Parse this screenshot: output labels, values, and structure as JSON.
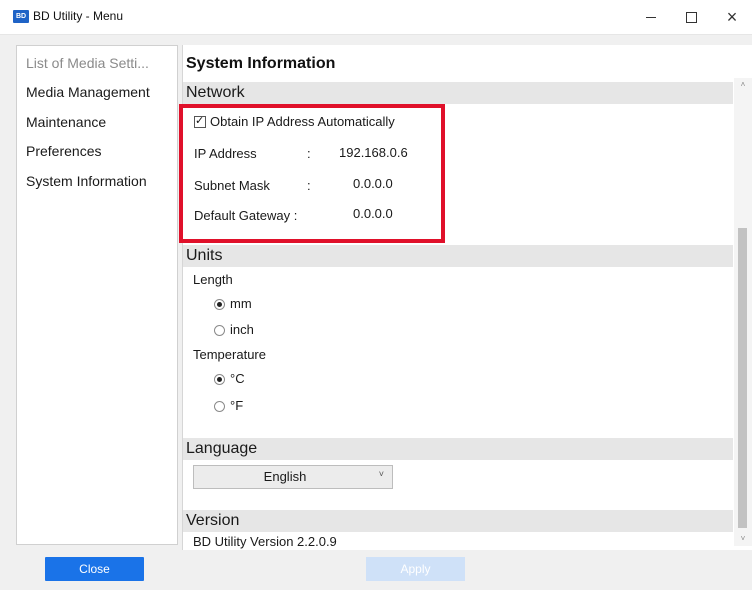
{
  "window": {
    "icon_text": "BD",
    "title": "BD Utility - Menu",
    "controls": {
      "minimize": "–",
      "maximize": "",
      "close": "×"
    }
  },
  "sidebar": {
    "items": [
      {
        "label": "List of Media Setti...",
        "muted": true
      },
      {
        "label": "Media Management"
      },
      {
        "label": "Maintenance"
      },
      {
        "label": "Preferences"
      },
      {
        "label": "System Information"
      }
    ]
  },
  "main": {
    "title": "System Information",
    "network": {
      "header": "Network",
      "auto_ip_label": "Obtain IP Address Automatically",
      "auto_ip_checked": true,
      "ip_label": "IP Address",
      "ip_sep": ":",
      "ip_value": "192.168.0.6",
      "subnet_label": "Subnet Mask",
      "subnet_sep": ":",
      "subnet_value": "0.0.0.0",
      "gateway_label": "Default Gateway :",
      "gateway_value": "0.0.0.0"
    },
    "units": {
      "header": "Units",
      "length_label": "Length",
      "length_options": [
        "mm",
        "inch"
      ],
      "length_selected": "mm",
      "temperature_label": "Temperature",
      "temperature_options": [
        "°C",
        "°F"
      ],
      "temperature_selected": "°C"
    },
    "language": {
      "header": "Language",
      "selected": "English",
      "chevron": "˅"
    },
    "version": {
      "header": "Version",
      "text": "BD Utility Version 2.2.0.9"
    }
  },
  "buttons": {
    "close": "Close",
    "apply": "Apply"
  },
  "scrollbar": {
    "up": "˄",
    "down": "˅"
  },
  "colors": {
    "accent": "#1a73e8",
    "apply_disabled": "#cfe1f8",
    "highlight": "#e0102a",
    "section_bg": "#e6e6e6"
  }
}
